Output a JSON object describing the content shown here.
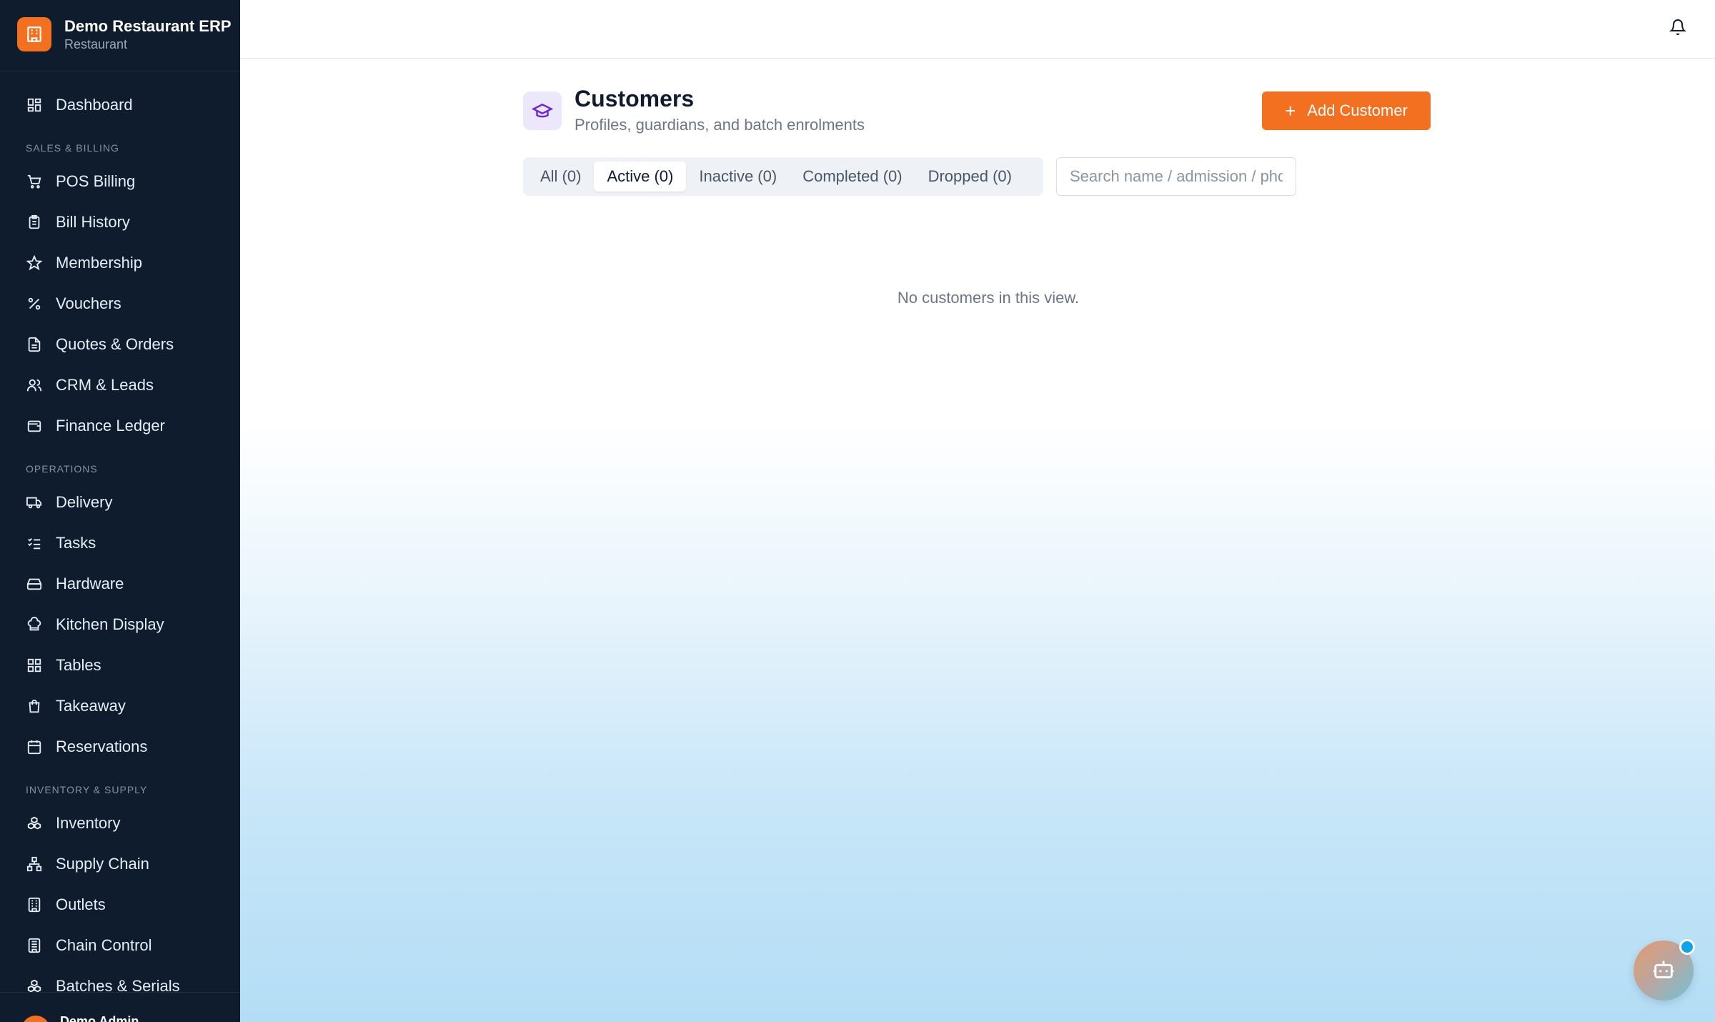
{
  "brand": {
    "title": "Demo Restaurant ERP",
    "subtitle": "Restaurant"
  },
  "sidebar": {
    "dashboard": "Dashboard",
    "sections": [
      {
        "title": "SALES & BILLING",
        "items": [
          "POS Billing",
          "Bill History",
          "Membership",
          "Vouchers",
          "Quotes & Orders",
          "CRM & Leads",
          "Finance Ledger"
        ]
      },
      {
        "title": "OPERATIONS",
        "items": [
          "Delivery",
          "Tasks",
          "Hardware",
          "Kitchen Display",
          "Tables",
          "Takeaway",
          "Reservations"
        ]
      },
      {
        "title": "INVENTORY & SUPPLY",
        "items": [
          "Inventory",
          "Supply Chain",
          "Outlets",
          "Chain Control",
          "Batches & Serials"
        ]
      }
    ],
    "user_name": "Demo Admin"
  },
  "page": {
    "title": "Customers",
    "subtitle": "Profiles, guardians, and batch enrolments",
    "add_button": "Add Customer",
    "tabs": [
      "All (0)",
      "Active (0)",
      "Inactive (0)",
      "Completed (0)",
      "Dropped (0)"
    ],
    "active_tab": "Active (0)",
    "search_placeholder": "Search name / admission / phone",
    "empty_message": "No customers in this view."
  },
  "colors": {
    "accent": "#f37021",
    "sidebar_bg": "#0f1c2e",
    "icon_purple": "#6d28d9",
    "notify_dot": "#0ea5e9"
  },
  "icons": {
    "brand": "building-icon",
    "page": "graduation-cap-icon",
    "topbar": "bell-icon",
    "floating": "robot-icon"
  }
}
